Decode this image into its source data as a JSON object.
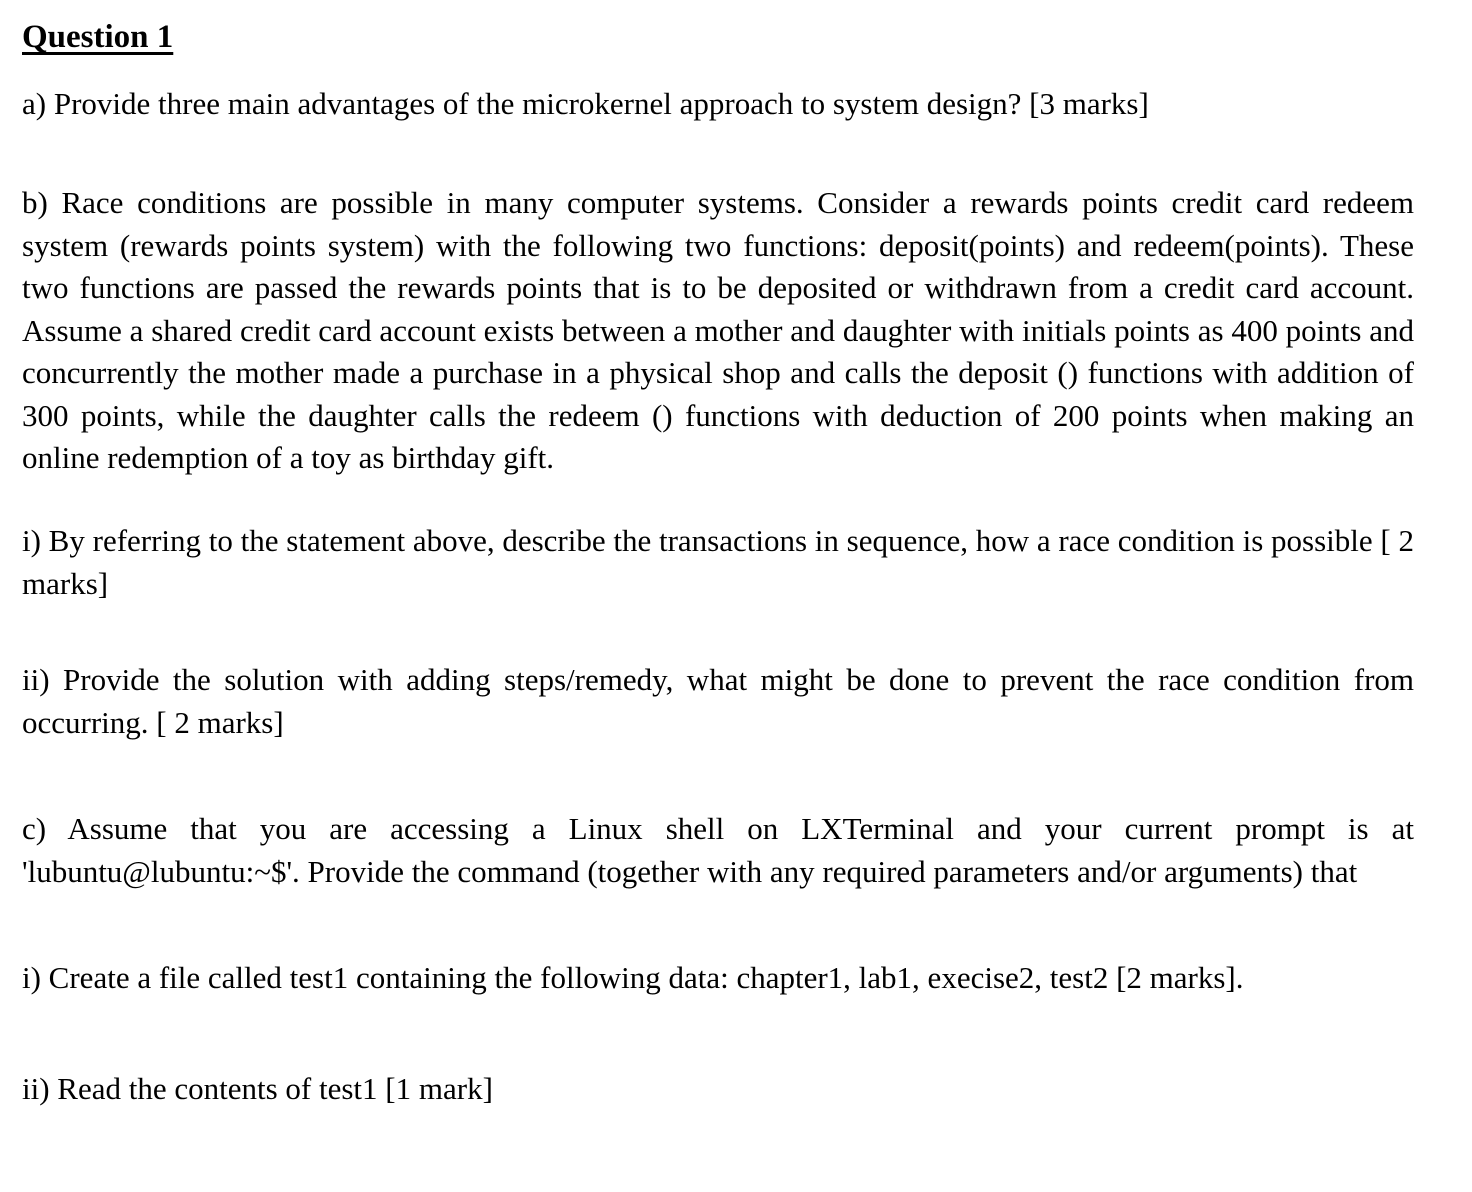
{
  "question": {
    "title": "Question 1"
  },
  "part_a": {
    "text": "a) Provide three main advantages of the microkernel approach to system design? [3 marks]"
  },
  "part_b": {
    "text": "b) Race conditions are possible in many computer systems. Consider a rewards points credit card redeem system (rewards points system) with the following two functions: deposit(points) and redeem(points). These two functions are passed the rewards points that is to be deposited or withdrawn from a credit card account. Assume a shared credit card account exists between a mother and daughter with initials points as 400 points and concurrently the mother made a purchase in a physical shop and calls the deposit () functions with addition of 300 points, while the daughter calls the redeem () functions with deduction of 200 points when making an online redemption of a toy as birthday gift.",
    "sub_i": "i) By referring to the statement above, describe the transactions in sequence, how a race condition is possible [ 2 marks]",
    "sub_ii": "ii) Provide the solution with adding steps/remedy, what might be done to prevent the race condition from occurring. [ 2 marks]"
  },
  "part_c": {
    "text": "c)  Assume that you are accessing a Linux shell on LXTerminal and your current prompt is at 'lubuntu@lubuntu:~$'. Provide the command (together with any required parameters and/or arguments) that",
    "sub_i": "i) Create a file called test1 containing the following data: chapter1, lab1, execise2, test2 [2 marks].",
    "sub_ii": "ii) Read the contents of test1 [1 mark]"
  }
}
